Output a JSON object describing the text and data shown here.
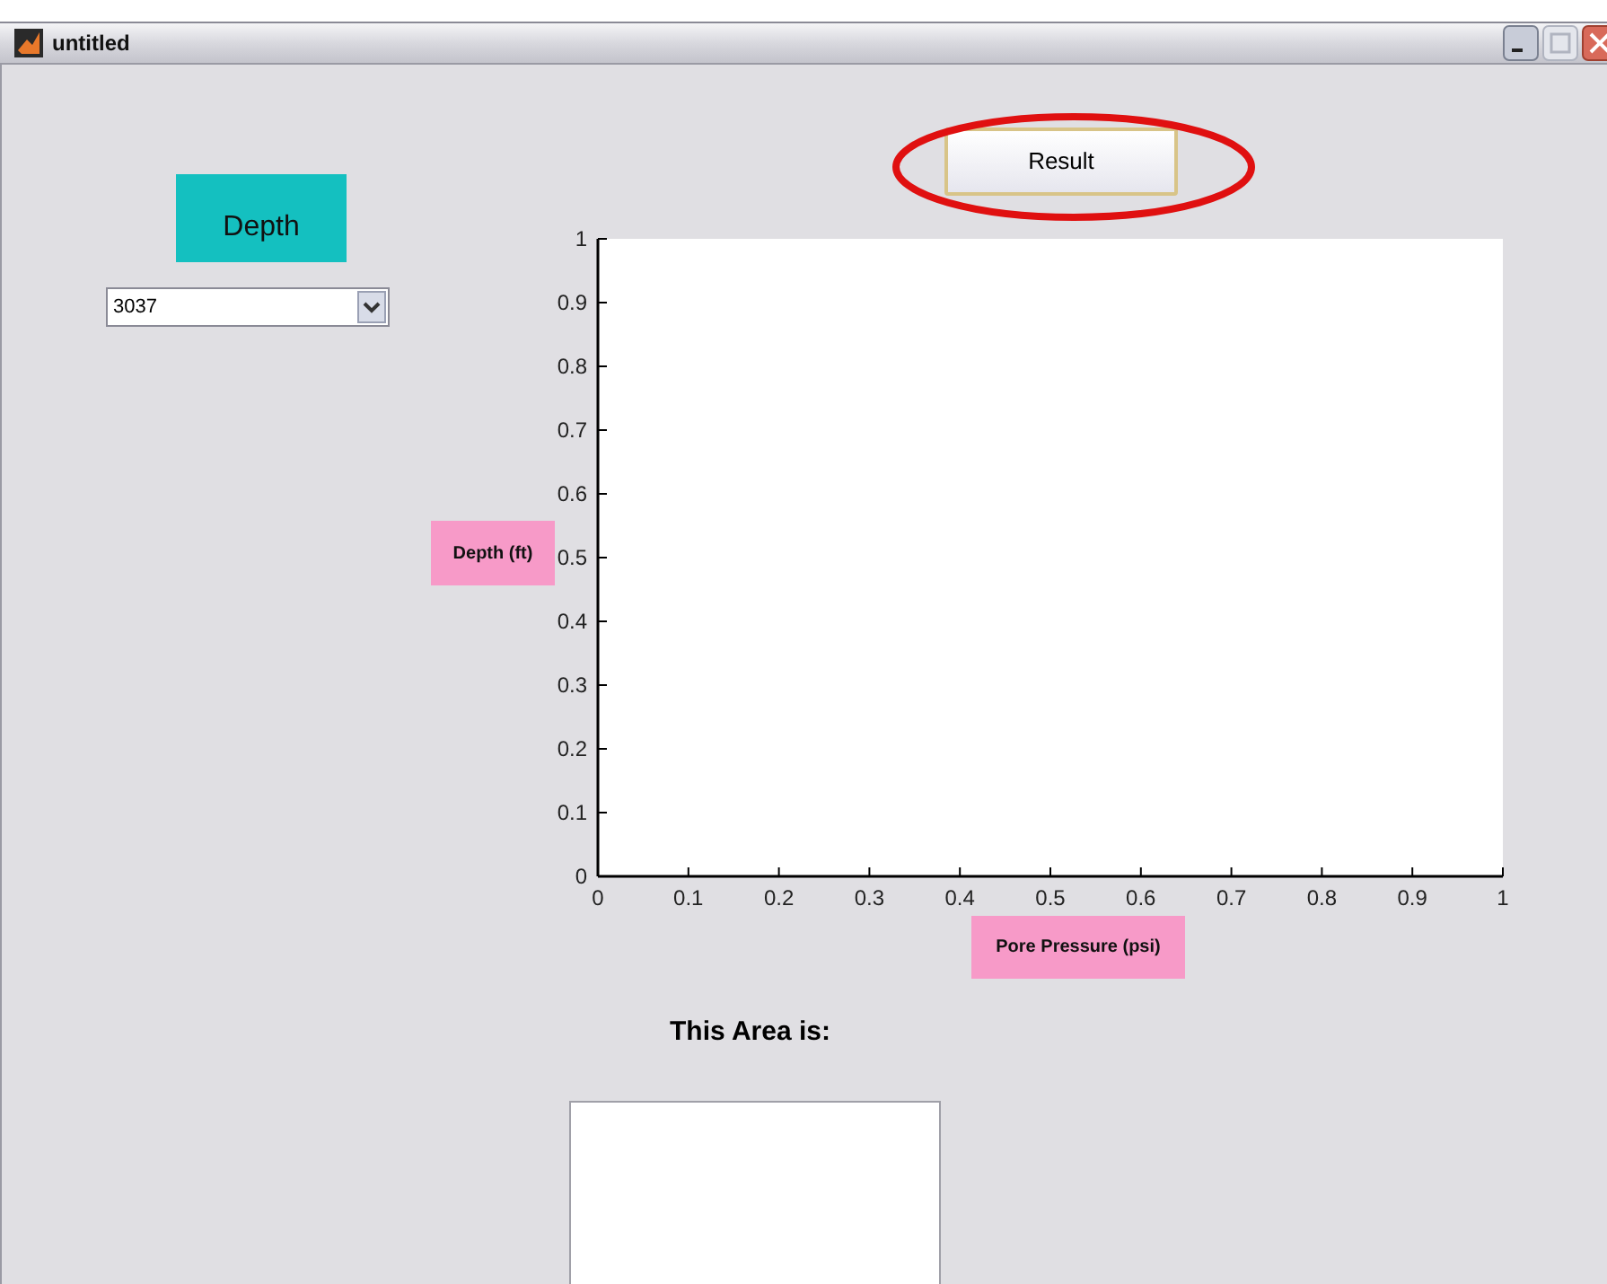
{
  "window": {
    "title": "untitled"
  },
  "depth_label": "Depth",
  "depth_dropdown": {
    "value": "3037"
  },
  "result_button": "Result",
  "y_axis_label": "Depth (ft)",
  "x_axis_label": "Pore Pressure (psi)",
  "axes": {
    "chart_data": {
      "type": "line",
      "xlim": [
        0,
        1
      ],
      "ylim": [
        0,
        1
      ],
      "xticks": [
        0,
        0.1,
        0.2,
        0.3,
        0.4,
        0.5,
        0.6,
        0.7,
        0.8,
        0.9,
        1
      ],
      "yticks": [
        0,
        0.1,
        0.2,
        0.3,
        0.4,
        0.5,
        0.6,
        0.7,
        0.8,
        0.9,
        1
      ]
    }
  },
  "area_label": "This Area is:"
}
